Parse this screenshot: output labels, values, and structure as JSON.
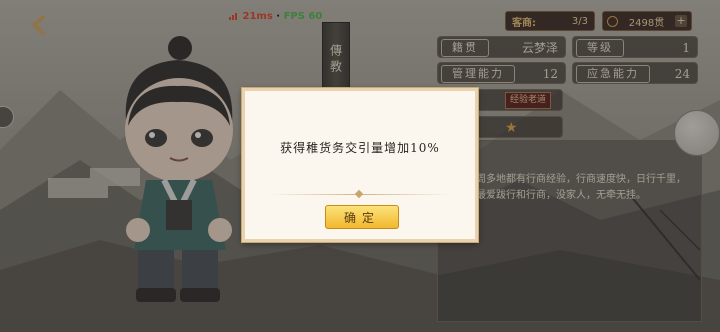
{
  "hud": {
    "ping": "21ms",
    "fps": "FPS 60",
    "back_icon": "back-arrow-icon"
  },
  "banner": {
    "title": "傳教"
  },
  "topbar": {
    "guest_label": "客商:",
    "guest_count": "3/3",
    "money": "2498贯",
    "plus": "+"
  },
  "stats": {
    "origin_label": "籍贯",
    "origin_value": "云梦泽",
    "level_label": "等级",
    "level_value": "1",
    "manage_label": "管理能力",
    "manage_value": "12",
    "emergency_label": "应急能力",
    "emergency_value": "24"
  },
  "trait": {
    "tag": "经验老道",
    "star": "★"
  },
  "description": {
    "text": "周多地都有行商经验，行商速度快，日行千里，最爱跋行和行商，没家人，无牵无挂。"
  },
  "dialog": {
    "message": "获得稚货务交引量增加10%",
    "confirm_label": "确定"
  },
  "colors": {
    "accent": "#f1b82e",
    "panel": "#fbf7ee",
    "trait_bg": "#5a1f1c",
    "fps": "#4bb84b",
    "ping": "#e0452a"
  }
}
